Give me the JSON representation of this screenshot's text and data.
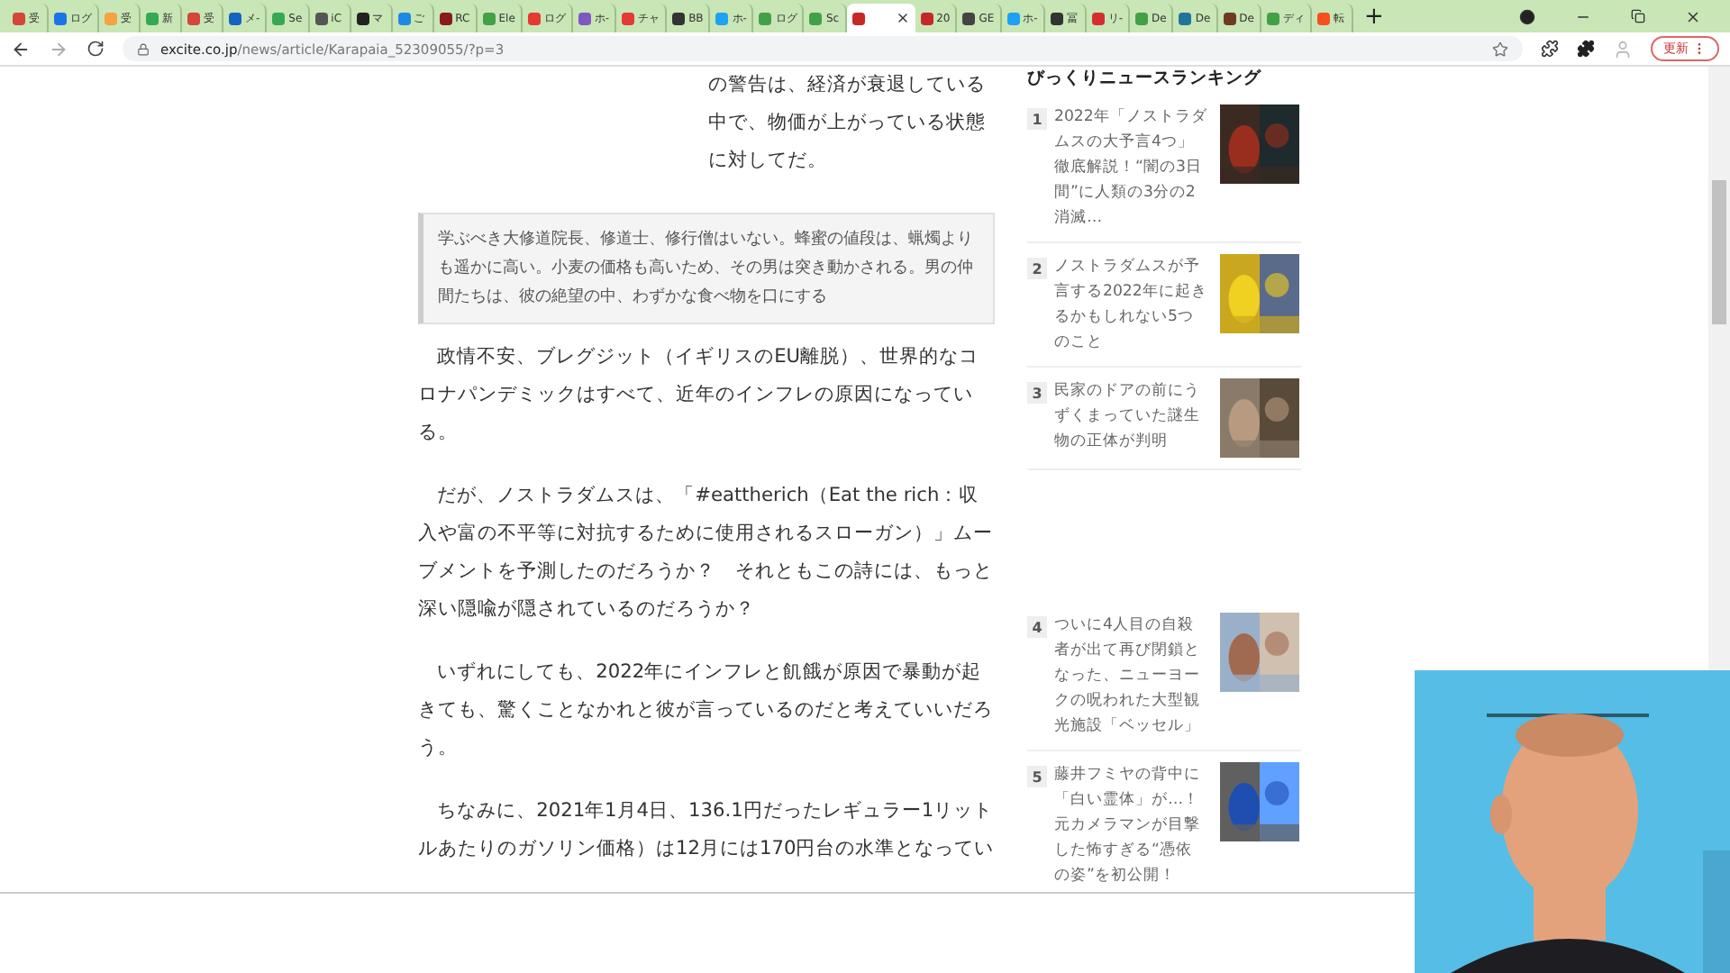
{
  "tabs": [
    {
      "label": "受",
      "color": "#d44638",
      "selected": false
    },
    {
      "label": "ログ",
      "color": "#1a73e8",
      "selected": false
    },
    {
      "label": "受",
      "color": "#f4a340",
      "selected": false
    },
    {
      "label": "新",
      "color": "#34a853",
      "selected": false
    },
    {
      "label": "受",
      "color": "#d44638",
      "selected": false
    },
    {
      "label": "メ-",
      "color": "#1565c0",
      "selected": false
    },
    {
      "label": "Se",
      "color": "#34a853",
      "selected": false
    },
    {
      "label": "iC",
      "color": "#555555",
      "selected": false
    },
    {
      "label": "マ",
      "color": "#222222",
      "selected": false
    },
    {
      "label": "ご",
      "color": "#1e88e5",
      "selected": false
    },
    {
      "label": "RC",
      "color": "#8b1a1a",
      "selected": false
    },
    {
      "label": "Ele",
      "color": "#43a047",
      "selected": false
    },
    {
      "label": "ログ",
      "color": "#e53935",
      "selected": false
    },
    {
      "label": "ホ-",
      "color": "#7e57c2",
      "selected": false
    },
    {
      "label": "チャ",
      "color": "#e53935",
      "selected": false
    },
    {
      "label": "BB",
      "color": "#333333",
      "selected": false
    },
    {
      "label": "ホ-",
      "color": "#1da1f2",
      "selected": false
    },
    {
      "label": "ログ",
      "color": "#43a047",
      "selected": false
    },
    {
      "label": "Sc",
      "color": "#43a047",
      "selected": false
    },
    {
      "color": "#c62828",
      "selected": true
    },
    {
      "label": "20",
      "color": "#c62828",
      "selected": false
    },
    {
      "label": "GE",
      "color": "#444444",
      "selected": false
    },
    {
      "label": "ホ-",
      "color": "#1da1f2",
      "selected": false
    },
    {
      "label": "冨",
      "color": "#333333",
      "selected": false
    },
    {
      "label": "リ-",
      "color": "#d32f2f",
      "selected": false
    },
    {
      "label": "De",
      "color": "#43a047",
      "selected": false
    },
    {
      "label": "De",
      "color": "#21759b",
      "selected": false
    },
    {
      "label": "De",
      "color": "#6d3b1f",
      "selected": false
    },
    {
      "label": "ディ",
      "color": "#43a047",
      "selected": false
    },
    {
      "label": "転",
      "color": "#f4511e",
      "selected": false
    }
  ],
  "new_tab": "+",
  "address": {
    "domain": "excite.co.jp",
    "path": "/news/article/Karapaia_52309055/?p=3"
  },
  "update_button": "更新",
  "article": {
    "intro": "の警告は、経済が衰退している中で、物価が上がっている状態に対してだ。",
    "quote": "学ぶべき大修道院長、修道士、修行僧はいない。蜂蜜の値段は、蝋燭よりも遥かに高い。小麦の価格も高いため、その男は突き動かされる。男の仲間たちは、彼の絶望の中、わずかな食べ物を口にする",
    "paragraphs": [
      "政情不安、ブレグジット（イギリスのEU離脱）、世界的なコロナパンデミックはすべて、近年のインフレの原因になっている。",
      "だが、ノストラダムスは、「#eattherich（Eat the rich：収入や富の不平等に対抗するために使用されるスローガン）」ムーブメントを予測したのだろうか？　それともこの詩には、もっと深い隠喩が隠されているのだろうか？",
      "いずれにしても、2022年にインフレと飢餓が原因で暴動が起きても、驚くことなかれと彼が言っているのだと考えていいだろう。",
      "ちなみに、2021年1月4日、136.1円だったレギュラー1リットルあたりのガソリン価格）は12月には170円台の水準となってい"
    ]
  },
  "ranking": {
    "title": "びっくりニュースランキング",
    "items": [
      {
        "rank": "1",
        "title": "2022年「ノストラダムスの大予言4つ」徹底解説！“闇の3日間”に人類の3分の2消滅…"
      },
      {
        "rank": "2",
        "title": "ノストラダムスが予言する2022年に起きるかもしれない5つのこと"
      },
      {
        "rank": "3",
        "title": "民家のドアの前にうずくまっていた謎生物の正体が判明"
      }
    ],
    "more_items": [
      {
        "rank": "4",
        "title": "ついに4人目の自殺者が出て再び閉鎖となった、ニューヨークの呪われた大型観光施設「ベッセル」"
      },
      {
        "rank": "5",
        "title": "藤井フミヤの背中に「白い霊体」が…！元カメラマンが目撃した怖すぎる“憑依の姿”を初公開！"
      }
    ]
  }
}
